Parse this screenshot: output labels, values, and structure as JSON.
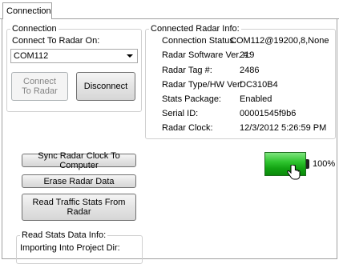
{
  "tabs": [
    {
      "label": "Connection"
    }
  ],
  "connection_group": {
    "legend": "Connection",
    "connect_label": "Connect To Radar On:",
    "port_value": "COM112",
    "connect_button": "Connect To Radar",
    "disconnect_button": "Disconnect"
  },
  "radar_info": {
    "legend": "Connected Radar Info:",
    "rows": [
      {
        "label": "Connection Status:",
        "value": "COM112@19200,8,None"
      },
      {
        "label": "Radar Software Ver. #:",
        "value": "219"
      },
      {
        "label": "Radar Tag #:",
        "value": "2486"
      },
      {
        "label": "Radar Type/HW Ver:",
        "value": "DC310B4"
      },
      {
        "label": "Stats Package:",
        "value": "Enabled"
      },
      {
        "label": "Serial ID:",
        "value": "00001545f9b6"
      },
      {
        "label": "Radar Clock:",
        "value": "12/3/2012 5:26:59 PM"
      }
    ]
  },
  "actions": {
    "sync_clock": "Sync Radar Clock To Computer",
    "erase_data": "Erase Radar Data",
    "read_stats": "Read Traffic Stats From Radar"
  },
  "battery": {
    "level_percent": 100,
    "label": "100%",
    "color": "#22b422",
    "icon": "battery-icon"
  },
  "read_stats_group": {
    "legend": "Read Stats Data Info:",
    "import_label": "Importing Into Project Dir:"
  }
}
